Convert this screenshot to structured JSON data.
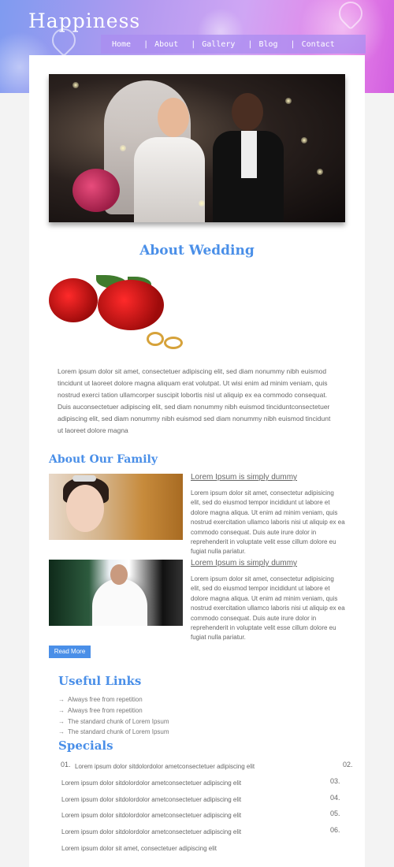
{
  "site": {
    "title": "Happiness"
  },
  "nav": {
    "items": [
      {
        "label": "Home"
      },
      {
        "label": "About"
      },
      {
        "label": "Gallery"
      },
      {
        "label": "Blog"
      },
      {
        "label": "Contact"
      }
    ],
    "separator": "|"
  },
  "about": {
    "title": "About Wedding",
    "text": "Lorem ipsum dolor sit amet, consectetuer adipiscing elit, sed diam nonummy nibh euismod tincidunt ut laoreet dolore magna aliquam erat volutpat. Ut wisi enim ad minim veniam, quis nostrud exerci tation ullamcorper suscipit lobortis nisl ut aliquip ex ea commodo consequat. Duis auconsectetuer adipiscing elit, sed diam nonummy nibh euismod tinciduntconsectetuer adipiscing elit, sed diam nonummy nibh euismod sed diam nonummy nibh euismod tincidunt ut laoreet dolore magna"
  },
  "family": {
    "title": "About Our Family",
    "entries": [
      {
        "heading": "Lorem Ipsum is simply dummy",
        "text": "Lorem ipsum dolor sit amet, consectetur adipisicing elit, sed do eiusmod tempor incididunt ut labore et dolore magna aliqua. Ut enim ad minim veniam, quis nostrud exercitation ullamco laboris nisi ut aliquip ex ea commodo consequat. Duis aute irure dolor in reprehenderit in voluptate velit esse cillum dolore eu fugiat nulla pariatur."
      },
      {
        "heading": "Lorem Ipsum is simply dummy",
        "text": "Lorem ipsum dolor sit amet, consectetur adipisicing elit, sed do eiusmod tempor incididunt ut labore et dolore magna aliqua. Ut enim ad minim veniam, quis nostrud exercitation ullamco laboris nisi ut aliquip ex ea commodo consequat. Duis aute irure dolor in reprehenderit in voluptate velit esse cillum dolore eu fugiat nulla pariatur."
      }
    ],
    "read_more": "Read More"
  },
  "useful_links": {
    "title": "Useful Links",
    "arrow": "→",
    "items": [
      {
        "label": "Always free from repetition"
      },
      {
        "label": "Always free from repetition"
      },
      {
        "label": "The standard chunk of Lorem Ipsum"
      },
      {
        "label": "The standard chunk of Lorem Ipsum"
      }
    ]
  },
  "specials": {
    "title": "Specials",
    "rows": [
      {
        "num": "01.",
        "text": "Lorem ipsum dolor sitdolordolor ametconsectetuer adipiscing elit",
        "num_right": "02."
      },
      {
        "text": "Lorem ipsum dolor sitdolordolor ametconsectetuer adipiscing elit",
        "num_right": "03."
      },
      {
        "text": "Lorem ipsum dolor sitdolordolor ametconsectetuer adipiscing elit",
        "num_right": "04."
      },
      {
        "text": "Lorem ipsum dolor sitdolordolor ametconsectetuer adipiscing elit",
        "num_right": "05."
      },
      {
        "text": "Lorem ipsum dolor sitdolordolor ametconsectetuer adipiscing elit",
        "num_right": "06."
      },
      {
        "text": "Lorem ipsum dolor sit amet, consectetuer adipiscing elit"
      }
    ]
  },
  "colors": {
    "accent": "#4a8fe8",
    "nav_bg": "#aa8cf0"
  }
}
